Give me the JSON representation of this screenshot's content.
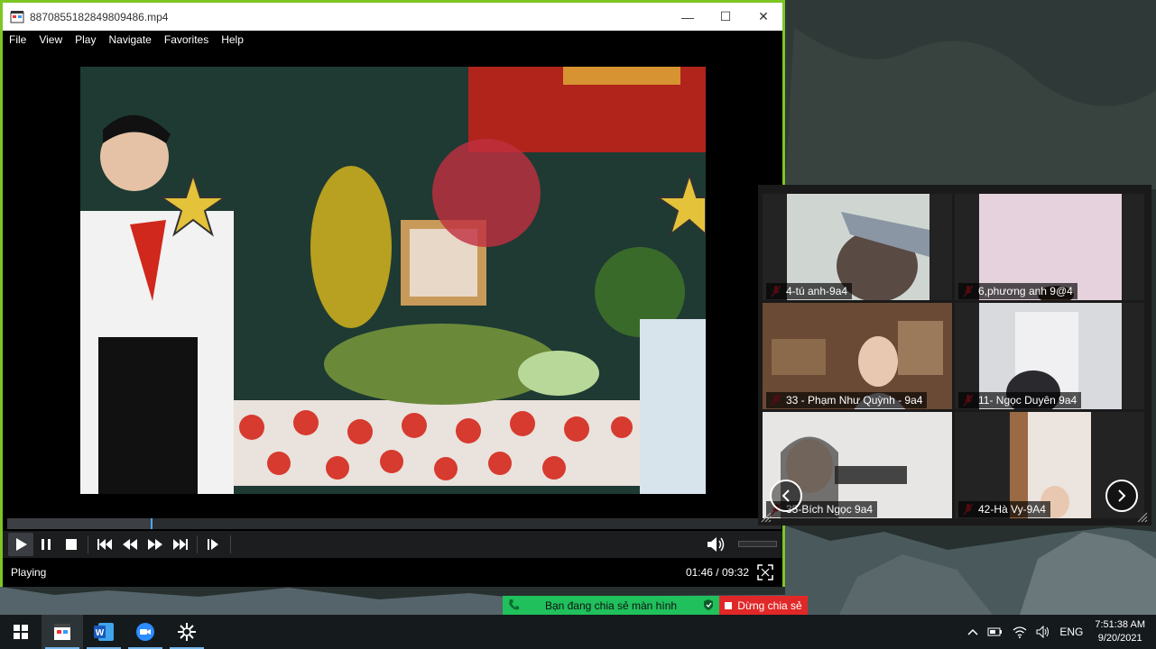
{
  "window": {
    "title": "8870855182849809486.mp4",
    "controls": {
      "minimize": "—",
      "maximize": "☐",
      "close": "✕"
    }
  },
  "menu": [
    "File",
    "View",
    "Play",
    "Navigate",
    "Favorites",
    "Help"
  ],
  "player": {
    "status": "Playing",
    "time": "01:46 / 09:32",
    "progress": 0.185
  },
  "zoom": {
    "participants": [
      {
        "name": "4-tú anh-9a4"
      },
      {
        "name": "6,phương anh 9@4"
      },
      {
        "name": "33 -  Phạm Như Quỳnh - 9a4"
      },
      {
        "name": "11- Ngọc Duyên 9a4"
      },
      {
        "name": "35-Bích Ngọc 9a4"
      },
      {
        "name": "42-Hà Vy-9A4"
      }
    ]
  },
  "share": {
    "message": "Bạn đang chia sẻ màn hình",
    "stop": "Dừng chia sẻ"
  },
  "taskbar": {
    "apps": [
      "media-player-icon",
      "word-icon",
      "zoom-icon",
      "snipping-tool-icon"
    ],
    "lang": "ENG",
    "time": "7:51:38 AM",
    "date": "9/20/2021"
  },
  "colors": {
    "window_border": "#7ec623",
    "share_green": "#20c05c",
    "stop_red": "#e02828",
    "seek_thumb": "#4ea4ff"
  }
}
